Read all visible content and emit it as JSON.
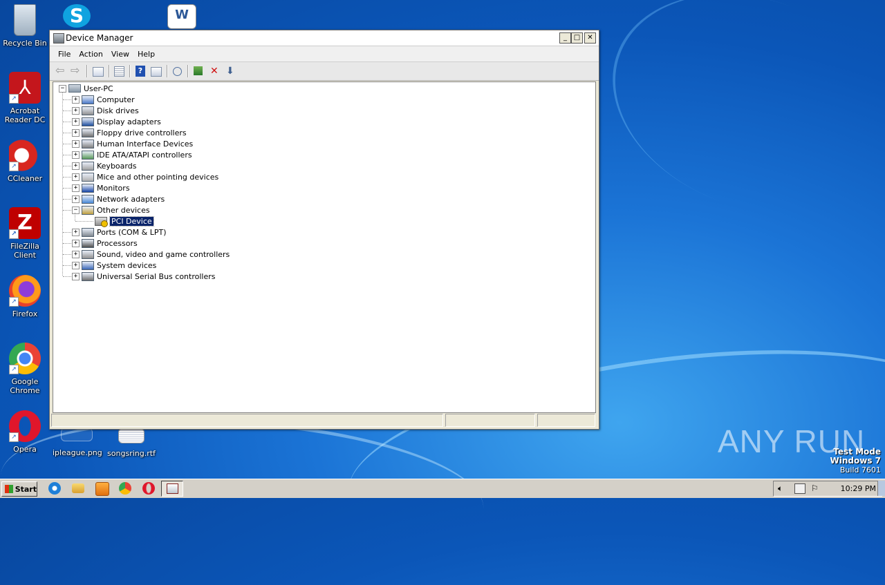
{
  "desktop": {
    "icons": [
      {
        "label": "Recycle Bin"
      },
      {
        "label": "Acrobat Reader DC"
      },
      {
        "label": "CCleaner"
      },
      {
        "label": "FileZilla Client"
      },
      {
        "label": "Firefox"
      },
      {
        "label": "Google Chrome"
      },
      {
        "label": "Opera"
      },
      {
        "label": "ipleague.png"
      },
      {
        "label": "songsring.rtf"
      }
    ],
    "watermark": "ANY RUN",
    "test_mode": {
      "line1": "Test Mode",
      "line2": "Windows 7",
      "line3": "Build 7601"
    }
  },
  "window": {
    "title": "Device Manager",
    "controls": {
      "minimize": "_",
      "maximize": "□",
      "close": "✕"
    },
    "menu": [
      "File",
      "Action",
      "View",
      "Help"
    ],
    "tree": {
      "root": "User-PC",
      "items": [
        {
          "label": "Computer",
          "expanded": false
        },
        {
          "label": "Disk drives",
          "expanded": false
        },
        {
          "label": "Display adapters",
          "expanded": false
        },
        {
          "label": "Floppy drive controllers",
          "expanded": false
        },
        {
          "label": "Human Interface Devices",
          "expanded": false
        },
        {
          "label": "IDE ATA/ATAPI controllers",
          "expanded": false
        },
        {
          "label": "Keyboards",
          "expanded": false
        },
        {
          "label": "Mice and other pointing devices",
          "expanded": false
        },
        {
          "label": "Monitors",
          "expanded": false
        },
        {
          "label": "Network adapters",
          "expanded": false
        },
        {
          "label": "Other devices",
          "expanded": true,
          "children": [
            {
              "label": "PCI Device",
              "selected": true
            }
          ]
        },
        {
          "label": "Ports (COM & LPT)",
          "expanded": false
        },
        {
          "label": "Processors",
          "expanded": false
        },
        {
          "label": "Sound, video and game controllers",
          "expanded": false
        },
        {
          "label": "System devices",
          "expanded": false
        },
        {
          "label": "Universal Serial Bus controllers",
          "expanded": false
        }
      ]
    }
  },
  "taskbar": {
    "start_label": "Start",
    "clock": "10:29 PM"
  },
  "colors": {
    "selection": "#0a246a",
    "desktop": "#1b74d6"
  }
}
